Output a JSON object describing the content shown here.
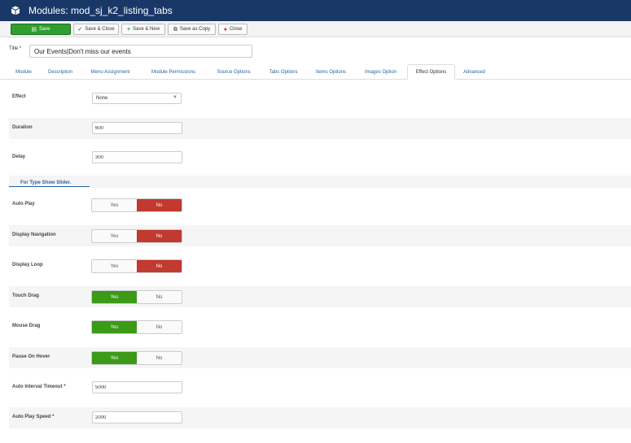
{
  "window": {
    "title": "Modules: mod_sj_k2_listing_tabs"
  },
  "toolbar": {
    "save": "Save",
    "save_close": "Save & Close",
    "save_new": "Save & New",
    "save_copy": "Save as Copy",
    "close": "Close"
  },
  "title_field": {
    "label": "Title *",
    "value": "Our Events|Don't miss our events"
  },
  "tabs": [
    {
      "label": "Module"
    },
    {
      "label": "Description"
    },
    {
      "label": "Menu Assignment"
    },
    {
      "label": "Module Permissions"
    },
    {
      "label": "Source Options"
    },
    {
      "label": "Tabs Options"
    },
    {
      "label": "Items Options"
    },
    {
      "label": "Images Option"
    },
    {
      "label": "Effect Options"
    },
    {
      "label": "Advanced"
    }
  ],
  "active_tab": "Effect Options",
  "fields": {
    "effect": {
      "label": "Effect",
      "value": "None"
    },
    "duration": {
      "label": "Duration",
      "value": "600"
    },
    "delay": {
      "label": "Delay",
      "value": "300"
    },
    "auto_interval_timeout": {
      "label": "Auto Interval Timeout *",
      "value": "5000"
    },
    "auto_play_speed": {
      "label": "Auto Play Speed *",
      "value": "2000"
    }
  },
  "section_heading": "For Type Show Slider.",
  "toggles": [
    {
      "label": "Auto Play",
      "yes": "Yes",
      "no": "No",
      "selected": "No"
    },
    {
      "label": "Display Navigation",
      "yes": "Yes",
      "no": "No",
      "selected": "No"
    },
    {
      "label": "Display Loop",
      "yes": "Yes",
      "no": "No",
      "selected": "No"
    },
    {
      "label": "Touch Drag",
      "yes": "Yes",
      "no": "No",
      "selected": "Yes"
    },
    {
      "label": "Mouse Drag",
      "yes": "Yes",
      "no": "No",
      "selected": "Yes"
    },
    {
      "label": "Pause On Hover",
      "yes": "Yes",
      "no": "No",
      "selected": "Yes"
    }
  ],
  "colors": {
    "header_bg": "#1a3867",
    "save_green": "#2f9e2f",
    "toggle_no_active": "#c1392f",
    "toggle_yes_active": "#3b9a16",
    "link_blue": "#2a64a0"
  },
  "icons": {
    "header": "cube-icon",
    "save": "save-icon",
    "save_close": "check-icon",
    "save_new": "plus-icon",
    "save_copy": "copy-icon",
    "close": "close-icon",
    "select": "chevron-down-icon"
  }
}
